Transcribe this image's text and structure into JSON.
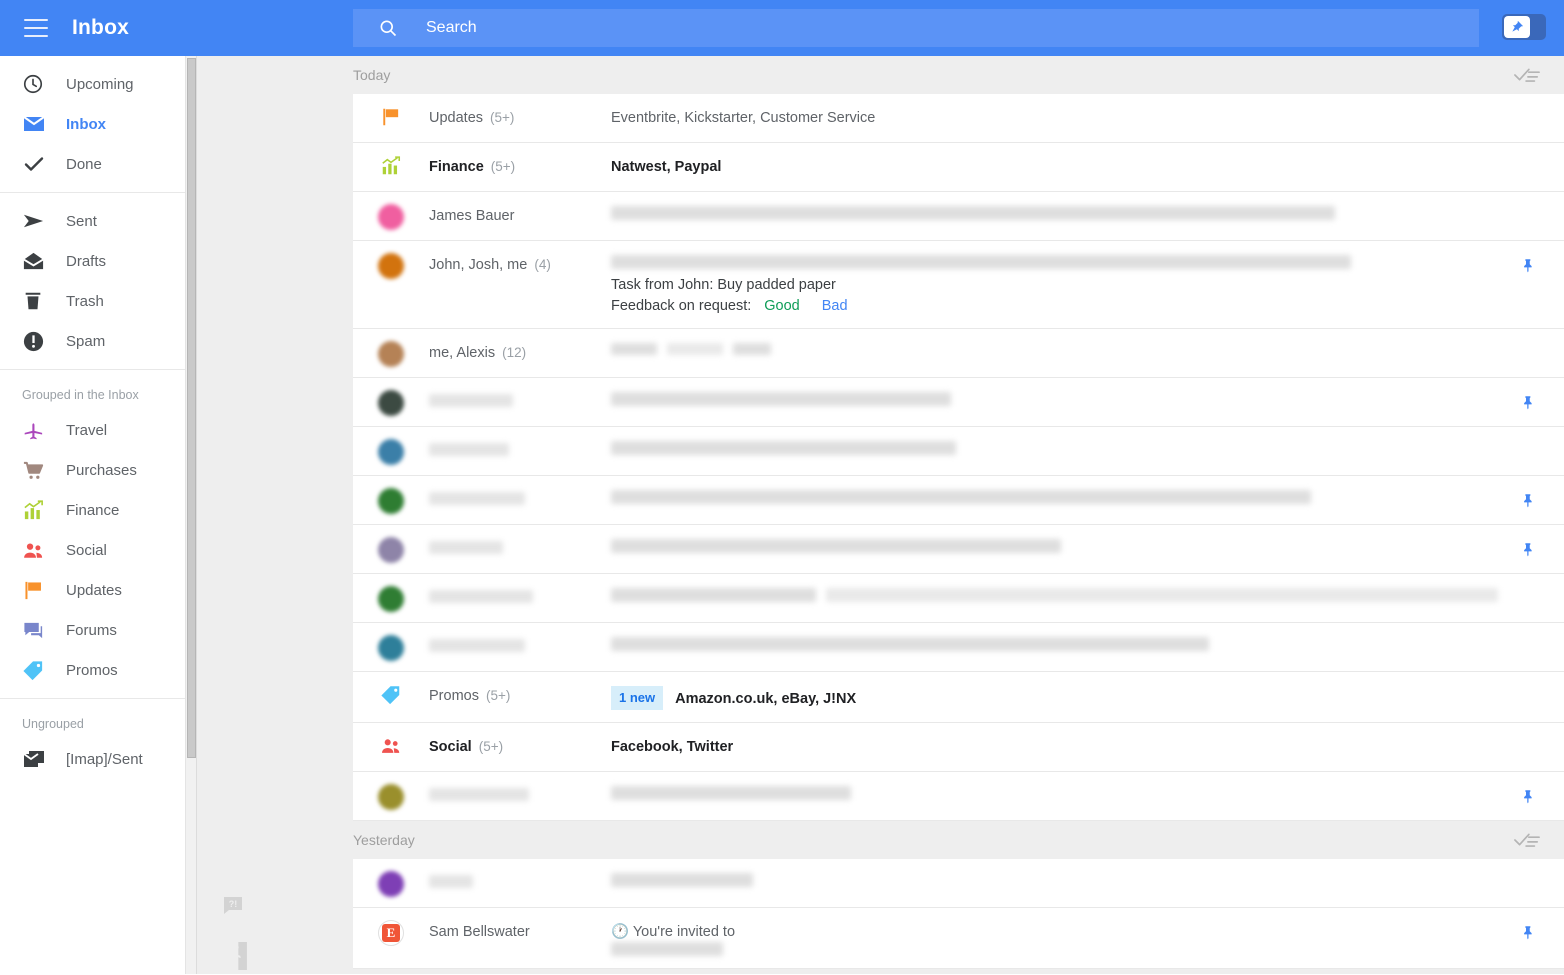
{
  "header": {
    "title": "Inbox",
    "menu_icon": "hamburger-icon",
    "search_placeholder": "Search",
    "search_value": "",
    "search_icon": "search-icon",
    "pin_toggle_icon": "pin-icon",
    "accent_color": "#4285f4"
  },
  "sidebar": {
    "groups": [
      {
        "label": "",
        "items": [
          {
            "label": "Upcoming",
            "icon": "clock-icon",
            "active": false
          },
          {
            "label": "Inbox",
            "icon": "envelope-icon",
            "active": true
          },
          {
            "label": "Done",
            "icon": "check-icon",
            "active": false
          }
        ]
      },
      {
        "label": "",
        "items": [
          {
            "label": "Sent",
            "icon": "send-icon",
            "active": false
          },
          {
            "label": "Drafts",
            "icon": "draft-envelope-icon",
            "active": false
          },
          {
            "label": "Trash",
            "icon": "trash-icon",
            "active": false
          },
          {
            "label": "Spam",
            "icon": "alert-icon",
            "active": false
          }
        ]
      },
      {
        "label": "Grouped in the Inbox",
        "items": [
          {
            "label": "Travel",
            "icon": "airplane-icon",
            "color": "#ab47bc",
            "active": false
          },
          {
            "label": "Purchases",
            "icon": "shopping-cart-icon",
            "color": "#a1887f",
            "active": false
          },
          {
            "label": "Finance",
            "icon": "chart-bars-icon",
            "color": "#aed136",
            "active": false
          },
          {
            "label": "Social",
            "icon": "people-icon",
            "color": "#ef5350",
            "active": false
          },
          {
            "label": "Updates",
            "icon": "flag-icon",
            "color": "#f8922c",
            "active": false
          },
          {
            "label": "Forums",
            "icon": "forum-bubbles-icon",
            "color": "#7986cb",
            "active": false
          },
          {
            "label": "Promos",
            "icon": "tag-icon",
            "color": "#4fc3f7",
            "active": false
          }
        ]
      },
      {
        "label": "Ungrouped",
        "items": [
          {
            "label": "[Imap]/Sent",
            "icon": "stacked-mail-icon",
            "color": "#3c4043",
            "active": false
          }
        ]
      }
    ]
  },
  "gutter": {
    "feedback_icon": "feedback-bubble-icon",
    "exit_icon": "running-man-exit-icon"
  },
  "main": {
    "sweep_icon": "mark-all-done-icon",
    "sections": [
      {
        "day": "Today",
        "rows": [
          {
            "icon": "flag-icon",
            "icon_color": "#f8922c",
            "sender": "Updates",
            "count": "(5+)",
            "bold": false,
            "subject": "Eventbrite, Kickstarter, Customer Service",
            "subject_bold": false,
            "pinned": false,
            "redacted": false
          },
          {
            "icon": "chart-bars-icon",
            "icon_color": "#aed136",
            "sender": "Finance",
            "count": "(5+)",
            "bold": true,
            "subject": "Natwest, Paypal",
            "subject_bold": true,
            "pinned": false,
            "redacted": false
          },
          {
            "icon": "avatar",
            "avatar_color": "#f05fa0",
            "sender": "James Bauer",
            "count": "",
            "bold": false,
            "subject": "",
            "subject_bold": false,
            "pinned": false,
            "redacted": true,
            "redact_bars": [
              [
                724,
                14
              ]
            ]
          },
          {
            "icon": "avatar",
            "avatar_color": "#d2730e",
            "sender": "John, Josh, me",
            "count": "(4)",
            "bold": false,
            "subject": "",
            "subject_bold": false,
            "pinned": true,
            "redacted": true,
            "redact_bars": [
              [
                740,
                14
              ]
            ],
            "task": "Task from John: Buy padded paper",
            "feedback_label": "Feedback on request:",
            "feedback_good": "Good",
            "feedback_bad": "Bad"
          },
          {
            "icon": "avatar",
            "avatar_color": "#b58256",
            "sender": "me, Alexis",
            "count": "(12)",
            "bold": false,
            "subject": "",
            "subject_bold": false,
            "pinned": false,
            "redacted": true,
            "redact_bars": [
              [
                46,
                12
              ],
              [
                56,
                12
              ],
              [
                38,
                12
              ]
            ]
          },
          {
            "icon": "avatar",
            "avatar_color": "#3c4a42",
            "sender": "",
            "count": "",
            "bold": false,
            "subject": "",
            "subject_bold": false,
            "pinned": true,
            "redacted": true,
            "sender_bar": [
              84,
              13
            ],
            "redact_bars": [
              [
                340,
                14
              ]
            ]
          },
          {
            "icon": "avatar",
            "avatar_color": "#3b7fa8",
            "sender": "",
            "count": "",
            "bold": false,
            "subject": "",
            "subject_bold": false,
            "pinned": false,
            "redacted": true,
            "sender_bar": [
              80,
              13
            ],
            "redact_bars": [
              [
                345,
                14
              ]
            ]
          },
          {
            "icon": "avatar",
            "avatar_color": "#2e7d32",
            "sender": "",
            "count": "",
            "bold": false,
            "subject": "",
            "subject_bold": false,
            "pinned": true,
            "redacted": true,
            "sender_bar": [
              96,
              13
            ],
            "redact_bars": [
              [
                700,
                14
              ]
            ]
          },
          {
            "icon": "avatar",
            "avatar_color": "#8e84a8",
            "sender": "",
            "count": "",
            "bold": false,
            "subject": "",
            "subject_bold": false,
            "pinned": true,
            "redacted": true,
            "sender_bar": [
              74,
              13
            ],
            "redact_bars": [
              [
                450,
                14
              ]
            ]
          },
          {
            "icon": "avatar",
            "avatar_color": "#2f7d33",
            "sender": "",
            "count": "",
            "bold": false,
            "subject": "",
            "subject_bold": false,
            "pinned": false,
            "redacted": true,
            "sender_bar": [
              104,
              13
            ],
            "redact_bars": [
              [
                205,
                14
              ],
              [
                672,
                14
              ]
            ]
          },
          {
            "icon": "avatar",
            "avatar_color": "#2e7f9a",
            "sender": "",
            "count": "",
            "bold": false,
            "subject": "",
            "subject_bold": false,
            "pinned": false,
            "redacted": true,
            "sender_bar": [
              96,
              13
            ],
            "redact_bars": [
              [
                598,
                14
              ]
            ]
          },
          {
            "icon": "tag-icon",
            "icon_color": "#4fc3f7",
            "sender": "Promos",
            "count": "(5+)",
            "bold": false,
            "subject": "Amazon.co.uk, eBay, J!NX",
            "subject_bold": true,
            "badge": "1 new",
            "pinned": false,
            "redacted": false
          },
          {
            "icon": "people-icon",
            "icon_color": "#ef5350",
            "sender": "Social",
            "count": "(5+)",
            "bold": true,
            "subject": "Facebook, Twitter",
            "subject_bold": true,
            "pinned": false,
            "redacted": false
          },
          {
            "icon": "avatar",
            "avatar_color": "#9a8f2c",
            "sender": "",
            "count": "",
            "bold": false,
            "subject": "",
            "subject_bold": false,
            "pinned": true,
            "redacted": true,
            "sender_bar": [
              100,
              13
            ],
            "redact_bars": [
              [
                240,
                14
              ]
            ]
          }
        ]
      },
      {
        "day": "Yesterday",
        "rows": [
          {
            "icon": "avatar",
            "avatar_color": "#7e3fb5",
            "sender": "",
            "count": "",
            "bold": false,
            "subject": "",
            "subject_bold": false,
            "pinned": false,
            "redacted": true,
            "sender_bar": [
              44,
              13
            ],
            "redact_bars": [
              [
                142,
                14
              ]
            ]
          },
          {
            "icon": "eventbrite-icon",
            "icon_color": "#f05537",
            "sender": "Sam Bellswater",
            "count": "",
            "bold": false,
            "subject_prefix": "You're invited to",
            "emoji": "clock-emoji",
            "subject_bold": false,
            "pinned": true,
            "redacted": true,
            "redact_bars": [
              [
                112,
                14
              ]
            ]
          }
        ]
      }
    ]
  }
}
